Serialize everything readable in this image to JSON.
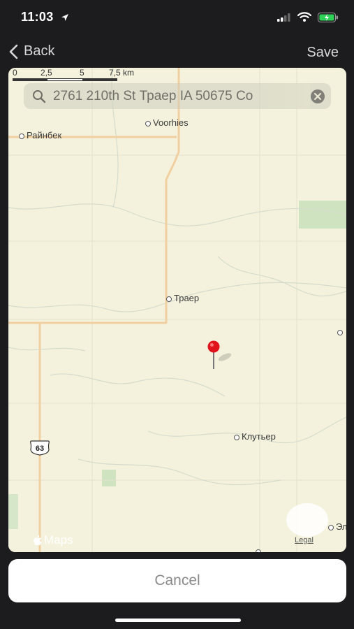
{
  "status_bar": {
    "time": "11:03",
    "icons": [
      "location-arrow-icon",
      "signal-icon",
      "wifi-icon",
      "battery-charging-icon"
    ]
  },
  "navbar": {
    "back_label": "Back",
    "save_label": "Save",
    "back_icon": "chevron-left-icon"
  },
  "map": {
    "scale": {
      "labels": [
        "0",
        "2,5",
        "5",
        "7,5 km"
      ]
    },
    "search": {
      "query": "2761 210th St Траер IA 50675 Co",
      "icon": "search-icon",
      "clear_icon": "clear-icon"
    },
    "places": {
      "voorhies": "Voorhies",
      "rainbeck": "Райнбек",
      "traer": "Траер",
      "clutier": "Клутьер",
      "el": "Эл"
    },
    "route_shield": "63",
    "pin_icon": "map-pin-icon",
    "logo_text": "Maps",
    "legal_label": "Legal",
    "colors": {
      "land": "#f4f2dd",
      "road": "#f0cfa0",
      "park": "#cfe3c0",
      "pin": "#e0141b"
    }
  },
  "cancel_label": "Cancel"
}
